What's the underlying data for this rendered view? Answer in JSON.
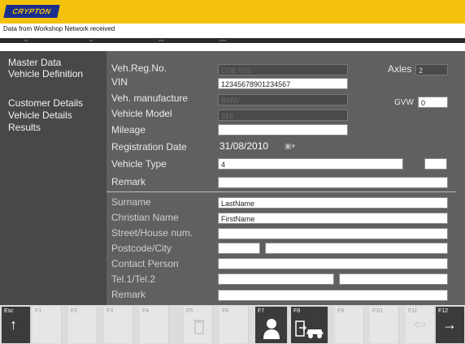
{
  "header": {
    "logo_text": "CRYPTON",
    "status_message": "Data from Workshop Network received"
  },
  "sidebar": {
    "items": [
      {
        "label": "Master Data"
      },
      {
        "label": "Vehicle Definition"
      },
      {
        "label": "Customer Details"
      },
      {
        "label": "Vehicle Details"
      },
      {
        "label": "Results"
      }
    ]
  },
  "vehicle": {
    "reg_label": "Veh.Reg.No.",
    "reg_value": "CDE 555",
    "vin_label": "VIN",
    "vin_value": "12345678901234567",
    "manufacturer_label": "Veh. manufacture",
    "manufacturer_value": "BMW",
    "model_label": "Vehicle Model",
    "model_value": "316",
    "mileage_label": "Mileage",
    "mileage_value": "",
    "regdate_label": "Registration Date",
    "regdate_value": "31/08/2010",
    "type_label": "Vehicle Type",
    "type_value": "4",
    "remark_label": "Remark",
    "remark_value": "",
    "axles_label": "Axles",
    "axles_value": "2",
    "gvw_label": "GVW",
    "gvw_value": "0"
  },
  "customer": {
    "surname_label": "Surname",
    "surname_value": "LastName",
    "christian_label": "Christian Name",
    "christian_value": "FirstName",
    "street_label": "Street/House num.",
    "postcode_label": "Postcode/City",
    "contact_label": "Contact Person",
    "tel_label": "Tel.1/Tel.2",
    "remark_label": "Remark"
  },
  "function_keys": [
    {
      "label": "Esc",
      "icon": "arrow-up-icon",
      "active": true
    },
    {
      "label": "F1",
      "active": false
    },
    {
      "label": "F2",
      "active": false
    },
    {
      "label": "F3",
      "active": false
    },
    {
      "label": "F4",
      "active": false
    },
    {
      "label": "F5",
      "icon": "trash-icon",
      "active": false
    },
    {
      "label": "F6",
      "active": false
    },
    {
      "label": "F7",
      "icon": "person-icon",
      "active": true
    },
    {
      "label": "F8",
      "icon": "car-export-icon",
      "active": true
    },
    {
      "label": "F9",
      "active": false
    },
    {
      "label": "F10",
      "active": false
    },
    {
      "label": "F11",
      "icon": "arrow-left-icon",
      "active": false
    },
    {
      "label": "F12",
      "icon": "arrow-right-icon",
      "active": true
    }
  ]
}
